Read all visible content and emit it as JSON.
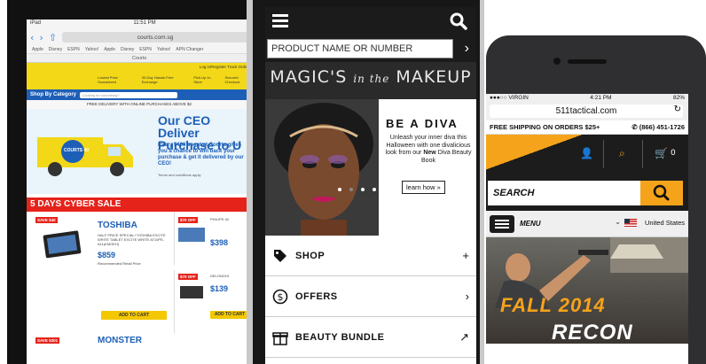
{
  "tablet": {
    "status_left": "iPad",
    "status_time": "11:51 PM",
    "url": "courts.com.sg",
    "bookmarks": [
      "Apple",
      "Disney",
      "ESPN",
      "Yahoo!",
      "Apple",
      "Disney",
      "ESPN",
      "Yahoo!",
      "APN Changer"
    ],
    "page_title": "Courts",
    "login_text": "Log in/Register  Track Order",
    "features": [
      "Lowest Price Guaranteed",
      "30-Day Hassle-Free Exchange",
      "Pick-Up In-Store",
      "Secured Checkout"
    ],
    "shop_by_category": "Shop By Category",
    "search_placeholder": "Looking for something?",
    "free_delivery": "FREE DELIVERY WITH ONLINE PURCHASES ABOVE $2",
    "ceo_title_1": "Our CEO Deliver",
    "ceo_title_2": "Purchase to U",
    "ceo_sub": "Every $400 spent at Courts gives you a chance to win back your purchase & get it delivered by our CEO!",
    "ceo_terms": "Terms and conditions apply",
    "truck_badge": "COURTS 40",
    "cyber_sale": "5 DAYS CYBER SALE",
    "deal1": {
      "badge": "SAVE $40",
      "brand": "TOSHIBA",
      "desc": "HALF PRICE SPECIAL! TOSHIBA EXCITE WRITE TABLET EXCITE WRITE AT10PE-A11(KMOEH)",
      "price": "$859",
      "desc2": "Recommended Retail Price",
      "cart": "ADD TO CART"
    },
    "deal2": {
      "badge": "$70 OFF",
      "brand_small": "PHILIPS 40",
      "price": "$398"
    },
    "deal3": {
      "badge": "$70 OFF",
      "brand_small": "DELONGHI",
      "price": "$139",
      "cart": "ADD TO CART"
    },
    "bottom_badge": "SAVE $301",
    "bottom_brand": "MONSTER"
  },
  "sephora": {
    "search_placeholder": "PRODUCT NAME OR NUMBER",
    "hero_title_a": "MAGIC'S",
    "hero_title_b": "in the",
    "hero_title_c": "MAKEUP",
    "diva_title": "BE A DIVA",
    "diva_copy_1": "Unleash your inner diva this Halloween with one divalicious look from our",
    "diva_copy_new": "New",
    "diva_copy_2": "Diva Beauty Book",
    "learn_how": "learn how »",
    "menu": [
      {
        "label": "SHOP",
        "arrow": "+"
      },
      {
        "label": "OFFERS",
        "arrow": "›"
      },
      {
        "label": "BEAUTY BUNDLE",
        "arrow": "↗"
      }
    ]
  },
  "tactical": {
    "carrier": "●●●○○ VIRGIN",
    "time": "4:21 PM",
    "battery": "82%",
    "url": "511tactical.com",
    "free_shipping": "FREE SHIPPING ON ORDERS $25+",
    "phone": "(866) 451-1726",
    "cart_count": "0",
    "search_label": "SEARCH",
    "menu_label": "MENU",
    "country": "United States",
    "hero_line1": "FALL 2014",
    "hero_line2": "RECON"
  },
  "colors": {
    "courts_yellow": "#f3d817",
    "courts_blue": "#1d5fb7",
    "courts_red": "#e5231b",
    "tactical_orange": "#f5a31a"
  }
}
